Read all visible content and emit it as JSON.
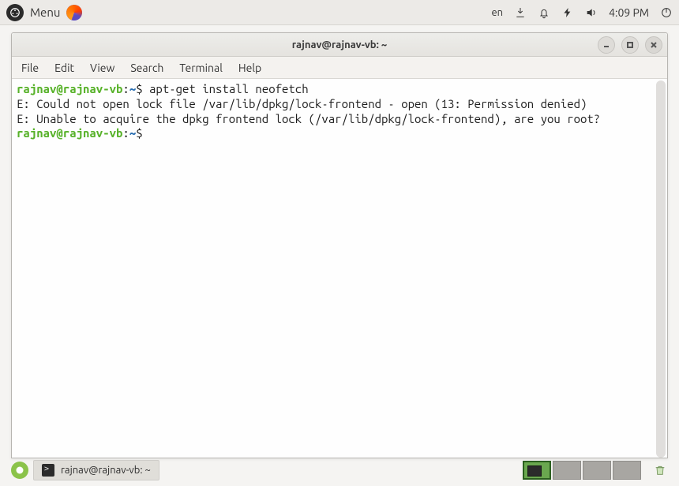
{
  "panel": {
    "menu_label": "Menu",
    "lang": "en",
    "time": "4:09 PM"
  },
  "window": {
    "title": "rajnav@rajnav-vb: ~",
    "menus": [
      "File",
      "Edit",
      "View",
      "Search",
      "Terminal",
      "Help"
    ]
  },
  "terminal": {
    "prompt_user": "rajnav@rajnav-vb",
    "prompt_path": "~",
    "cmd1": "apt-get install neofetch",
    "out1": "E: Could not open lock file /var/lib/dpkg/lock-frontend - open (13: Permission denied)",
    "out2": "E: Unable to acquire the dpkg frontend lock (/var/lib/dpkg/lock-frontend), are you root?"
  },
  "taskbar": {
    "active_task": "rajnav@rajnav-vb: ~"
  }
}
